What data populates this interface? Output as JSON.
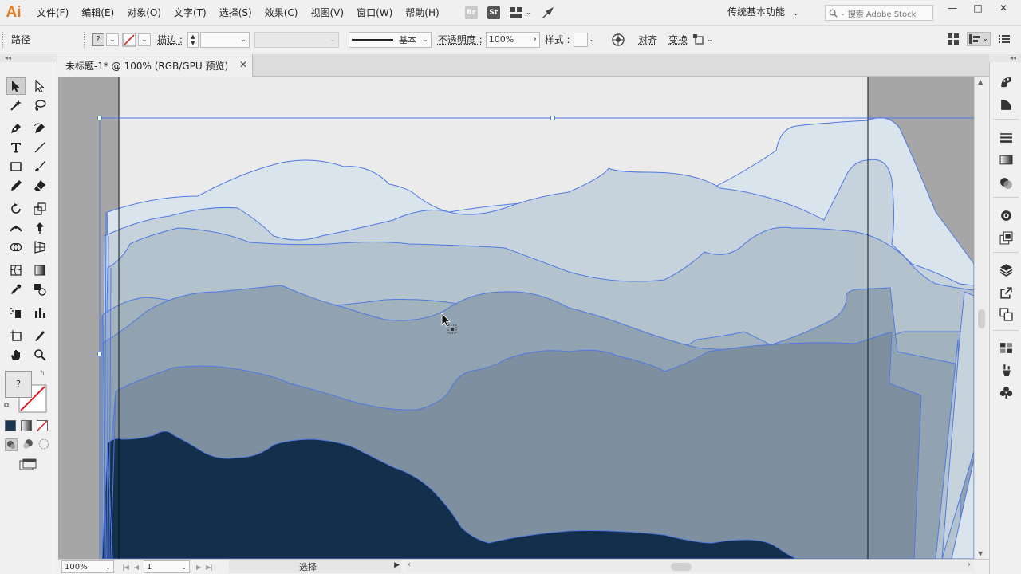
{
  "app": {
    "logo": "Ai",
    "menu": [
      "文件(F)",
      "编辑(E)",
      "对象(O)",
      "文字(T)",
      "选择(S)",
      "效果(C)",
      "视图(V)",
      "窗口(W)",
      "帮助(H)"
    ],
    "bridge_label": "Br",
    "stock_label": "St",
    "workspace": "传统基本功能",
    "stock_search_placeholder": "搜索 Adobe Stock",
    "window_controls": [
      "—",
      "□",
      "✕"
    ]
  },
  "control_bar": {
    "selection_label": "路径",
    "fill_value": "?",
    "stroke_label": "描边 :",
    "stroke_profile_label": "基本",
    "opacity_label": "不透明度 :",
    "opacity_value": "100%",
    "style_label": "样式 :",
    "align_label": "对齐",
    "transform_label": "变换"
  },
  "document": {
    "tab_title": "未标题-1* @ 100% (RGB/GPU 预览)",
    "close_glyph": "✕"
  },
  "tools": {
    "fill_value": "?"
  },
  "status_bar": {
    "zoom": "100%",
    "artboard_number": "1",
    "tool_name": "选择"
  },
  "artwork": {
    "layer_colors": [
      "#dae4ec",
      "#c6d3dc",
      "#b3c2cc",
      "#a3b3be",
      "#91a2b1",
      "#7e8f9f",
      "#142f4c"
    ],
    "pasteboard_color": "#a6a6a6",
    "artboard_color": "#ebebeb",
    "outline_color": "#4f79e2"
  },
  "icons": {
    "tools": [
      "selection-tool-icon",
      "direct-selection-tool-icon",
      "magic-wand-tool-icon",
      "lasso-tool-icon",
      "pen-tool-icon",
      "curvature-tool-icon",
      "type-tool-icon",
      "line-segment-tool-icon",
      "rectangle-tool-icon",
      "paintbrush-tool-icon",
      "pencil-tool-icon",
      "eraser-tool-icon",
      "rotate-tool-icon",
      "scale-tool-icon",
      "width-tool-icon",
      "puppet-warp-tool-icon",
      "shape-builder-tool-icon",
      "perspective-grid-tool-icon",
      "mesh-tool-icon",
      "gradient-tool-icon",
      "eyedropper-tool-icon",
      "blend-tool-icon",
      "symbol-sprayer-tool-icon",
      "column-graph-tool-icon",
      "artboard-tool-icon",
      "slice-tool-icon",
      "hand-tool-icon",
      "zoom-tool-icon"
    ],
    "dock": [
      "color-guide-icon",
      "color-icon",
      "stroke-icon",
      "gradient-icon",
      "transparency-icon",
      "appearance-icon",
      "graphic-styles-icon",
      "layers-icon",
      "export-icon",
      "artboards-icon",
      "swatches-icon",
      "brushes-icon",
      "symbols-icon"
    ]
  }
}
